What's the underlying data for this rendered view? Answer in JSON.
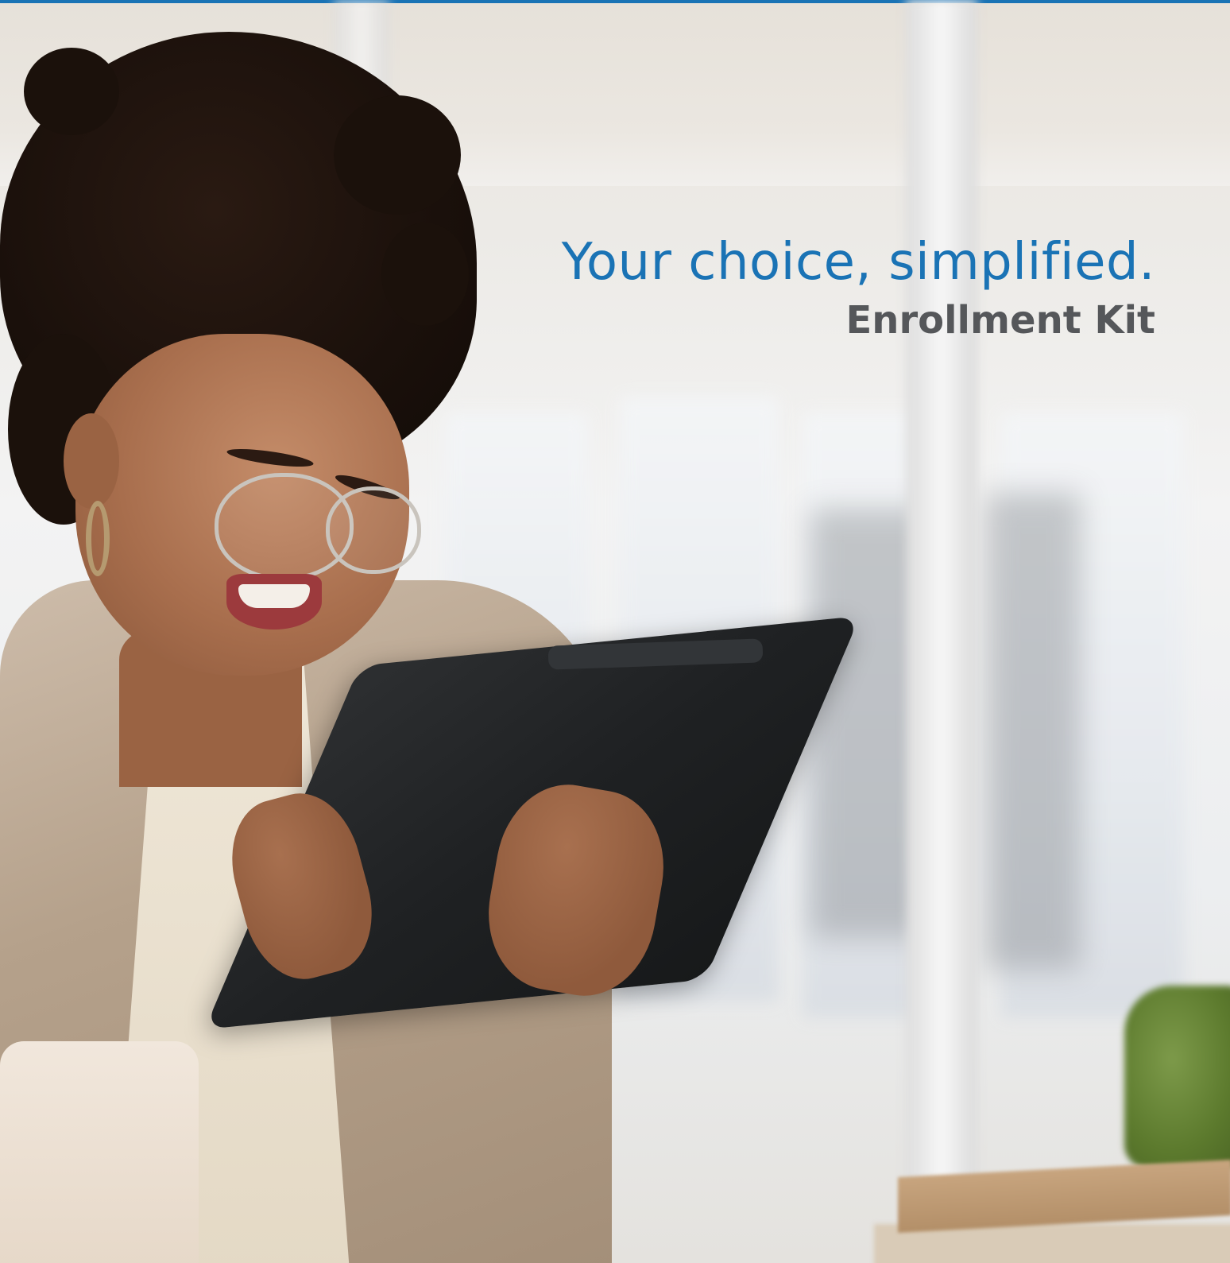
{
  "cover": {
    "headline": "Your choice, simplified.",
    "subheadline": "Enrollment Kit"
  },
  "colors": {
    "accent": "#1a73b5",
    "subheadline": "#55575a"
  },
  "photo": {
    "subject": "woman-with-tablet"
  }
}
